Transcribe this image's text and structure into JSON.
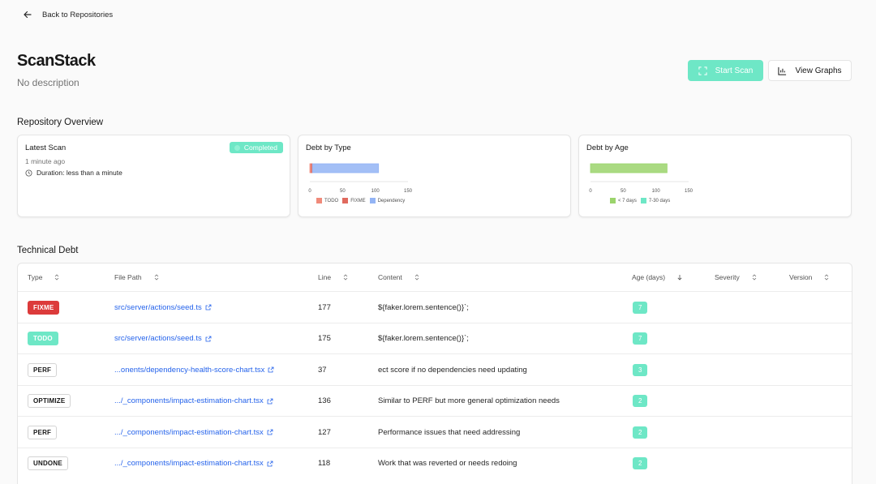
{
  "nav": {
    "back_label": "Back to Repositories"
  },
  "repo": {
    "name": "ScanStack",
    "description": "No description"
  },
  "actions": {
    "start_scan": "Start Scan",
    "view_graphs": "View Graphs"
  },
  "overview": {
    "title": "Repository Overview",
    "latest_scan": {
      "title": "Latest Scan",
      "status": "Completed",
      "time": "1 minute ago",
      "duration": "Duration: less than a minute"
    }
  },
  "chart_data": [
    {
      "type": "bar",
      "orientation": "horizontal-stacked",
      "title": "Debt by Type",
      "series": [
        {
          "name": "TODO",
          "values": [
            2
          ],
          "color": "#f08a7a"
        },
        {
          "name": "FIXME",
          "values": [
            2
          ],
          "color": "#e06a5e"
        },
        {
          "name": "Dependency",
          "values": [
            101
          ],
          "color": "#93b4f5"
        }
      ],
      "xlim": [
        0,
        150
      ],
      "xticks": [
        "0",
        "50",
        "100",
        "150"
      ],
      "legend": "bottom"
    },
    {
      "type": "bar",
      "orientation": "horizontal-stacked",
      "title": "Debt by Age",
      "series": [
        {
          "name": "< 7 days",
          "values": [
            117
          ],
          "color": "#9bd46c"
        },
        {
          "name": "7-30 days",
          "values": [
            0
          ],
          "color": "#6ee7c6"
        }
      ],
      "xlim": [
        0,
        150
      ],
      "xticks": [
        "0",
        "50",
        "100",
        "150"
      ],
      "legend": "bottom"
    }
  ],
  "debt": {
    "title": "Technical Debt",
    "columns": [
      "Type",
      "File Path",
      "Line",
      "Content",
      "Age (days)",
      "Severity",
      "Version"
    ],
    "rows": [
      {
        "type": "FIXME",
        "style": "fixme",
        "path": "src/server/actions/seed.ts",
        "line": "177",
        "content": "${faker.lorem.sentence()}`;",
        "age": "7"
      },
      {
        "type": "TODO",
        "style": "todo",
        "path": "src/server/actions/seed.ts",
        "line": "175",
        "content": "${faker.lorem.sentence()}`;",
        "age": "7"
      },
      {
        "type": "PERF",
        "style": "plain",
        "path": "...onents/dependency-health-score-chart.tsx",
        "line": "37",
        "content": "ect score if no dependencies need updating",
        "age": "3"
      },
      {
        "type": "OPTIMIZE",
        "style": "plain",
        "path": ".../_components/impact-estimation-chart.tsx",
        "line": "136",
        "content": "Similar to PERF but more general optimization needs",
        "age": "2"
      },
      {
        "type": "PERF",
        "style": "plain",
        "path": ".../_components/impact-estimation-chart.tsx",
        "line": "127",
        "content": "Performance issues that need addressing",
        "age": "2"
      },
      {
        "type": "UNDONE",
        "style": "plain",
        "path": ".../_components/impact-estimation-chart.tsx",
        "line": "118",
        "content": "Work that was reverted or needs redoing",
        "age": "2"
      }
    ]
  }
}
